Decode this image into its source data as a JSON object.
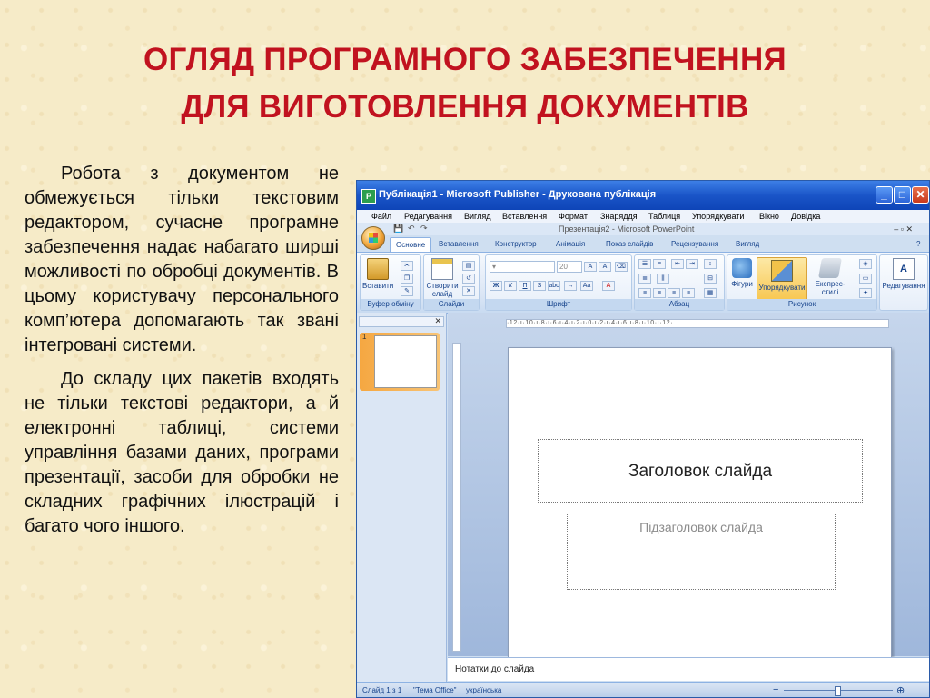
{
  "slide": {
    "title_line1": "ОГЛЯД ПРОГРАМНОГО ЗАБЕЗПЕЧЕННЯ",
    "title_line2": "ДЛЯ ВИГОТОВЛЕННЯ ДОКУМЕНТІВ",
    "paragraph1": "Робота з документом не обмежується тільки текстовим редактором, сучасне програмне забезпечення надає набагато ширші можливості по обробці документів. В цьому користувачу персонального комп’ютера допомагають так звані інтегровані системи.",
    "paragraph2": "До складу цих пакетів входять не тільки текстові редактори, а й електронні таблиці, системи управління базами даних, програми презентації, засоби для обробки не складних графічних ілюстрацій і багато чого іншого."
  },
  "window": {
    "title": "Публікація1 - Microsoft Publisher - Друкована публікація",
    "inner_title": "Презентація2 - Microsoft PowerPoint",
    "controls": {
      "minimize": "_",
      "maximize": "□",
      "close": "✕"
    },
    "menu": [
      "Файл",
      "Редагування",
      "Вигляд",
      "Вставлення",
      "Формат",
      "Знаряддя",
      "Таблиця",
      "Упорядкувати",
      "Вікно",
      "Довідка"
    ],
    "tabs": [
      "Основне",
      "Вставлення",
      "Конструктор",
      "Анімація",
      "Показ слайдів",
      "Рецензування",
      "Вигляд"
    ],
    "ribbon": {
      "paste": "Вставити",
      "new_slide_line1": "Створити",
      "new_slide_line2": "слайд",
      "shapes": "Фігури",
      "arrange": "Упорядкувати",
      "quick_styles": "Експрес-стилі",
      "editing": "Редагування",
      "font_size": "20",
      "groups": [
        "Буфер обміну",
        "Слайди",
        "Шрифт",
        "Абзац",
        "Рисунок"
      ]
    },
    "ruler_text": "·12·ı·10·ı·8·ı·6·ı·4·ı·2·ı·0·ı·2·ı·4·ı·6·ı·8·ı·10·ı·12·",
    "slide_placeholder_title": "Заголовок слайда",
    "slide_placeholder_subtitle": "Підзаголовок слайда",
    "thumbnail_number": "1",
    "notes": "Нотатки до слайда",
    "status": {
      "slide": "Слайд 1 з 1",
      "theme": "\"Тема Office\"",
      "language": "українська"
    }
  },
  "colors": {
    "title_red": "#c1121f",
    "titlebar_blue": "#1a55c8",
    "background_parchment": "#f6ebc8"
  }
}
